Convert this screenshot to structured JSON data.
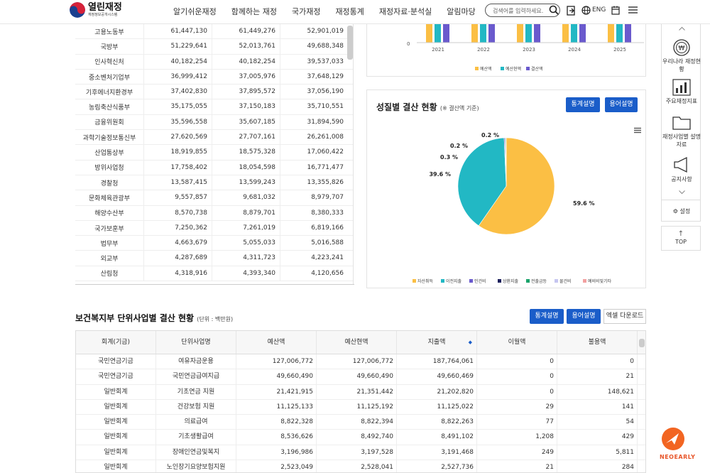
{
  "header": {
    "logo_title": "열린재정",
    "logo_sub": "재정정보공개시스템",
    "nav": [
      "알기쉬운재정",
      "함께하는 재정",
      "국가재정",
      "재정통계",
      "재정자료·분석실",
      "알림마당"
    ],
    "search_placeholder": "검색어를 입력하세요.",
    "lang": "ENG"
  },
  "ministry_table": {
    "rows": [
      [
        "고용노동부",
        "61,447,130",
        "61,449,276",
        "52,901,019"
      ],
      [
        "국방부",
        "51,229,641",
        "52,013,761",
        "49,688,348"
      ],
      [
        "인사혁신처",
        "40,182,254",
        "40,182,254",
        "39,537,033"
      ],
      [
        "중소벤처기업부",
        "36,999,412",
        "37,005,976",
        "37,648,129"
      ],
      [
        "기후에너지환경부",
        "37,402,830",
        "37,895,572",
        "37,056,190"
      ],
      [
        "농림축산식품부",
        "35,175,055",
        "37,150,183",
        "35,710,551"
      ],
      [
        "금융위원회",
        "35,596,558",
        "35,607,185",
        "31,894,590"
      ],
      [
        "과학기술정보통신부",
        "27,620,569",
        "27,707,161",
        "26,261,008"
      ],
      [
        "산업통상부",
        "18,919,855",
        "18,575,328",
        "17,060,422"
      ],
      [
        "방위사업청",
        "17,758,402",
        "18,054,598",
        "16,771,477"
      ],
      [
        "경찰청",
        "13,587,415",
        "13,599,243",
        "13,355,826"
      ],
      [
        "문화체육관광부",
        "9,557,857",
        "9,681,032",
        "8,979,707"
      ],
      [
        "해양수산부",
        "8,570,738",
        "8,879,701",
        "8,380,333"
      ],
      [
        "국가보훈부",
        "7,250,362",
        "7,261,019",
        "6,819,166"
      ],
      [
        "법무부",
        "4,663,679",
        "5,055,033",
        "5,016,588"
      ],
      [
        "외교부",
        "4,287,689",
        "4,311,723",
        "4,223,241"
      ],
      [
        "산림청",
        "4,318,916",
        "4,393,340",
        "4,120,656"
      ]
    ]
  },
  "top_chart": {
    "zero_label": "0",
    "years": [
      "2021",
      "2022",
      "2023",
      "2024",
      "2025"
    ],
    "legend": [
      "예산액",
      "예산현액",
      "결산액"
    ],
    "colors": [
      "#fbbf44",
      "#22b8c4",
      "#6a5acd"
    ]
  },
  "pie_panel": {
    "title": "성질별 결산 현황",
    "subtitle": "(※ 결산액 기준)",
    "btn_stats": "통계설명",
    "btn_terms": "용어설명",
    "labels": [
      "59.6 %",
      "39.6 %",
      "0.3 %",
      "0.2 %",
      "0.2 %"
    ],
    "legend": [
      {
        "name": "자산취득",
        "color": "#fbbf44"
      },
      {
        "name": "이전지출",
        "color": "#22b8c4"
      },
      {
        "name": "인건비",
        "color": "#6a5acd"
      },
      {
        "name": "상환지출",
        "color": "#1b1f5c"
      },
      {
        "name": "전출금등",
        "color": "#1aa36b"
      },
      {
        "name": "물건비",
        "color": "#c6c6f0"
      },
      {
        "name": "예비비및기타",
        "color": "#f2a0a0"
      }
    ]
  },
  "chart_data": {
    "type": "pie",
    "title": "성질별 결산 현황",
    "categories": [
      "자산취득",
      "이전지출",
      "인건비",
      "상환지출",
      "전출금등"
    ],
    "values": [
      59.6,
      39.6,
      0.3,
      0.2,
      0.2
    ],
    "colors": [
      "#fbbf44",
      "#22b8c4",
      "#6a5acd",
      "#1b1f5c",
      "#1aa36b"
    ]
  },
  "sidebar": {
    "items": [
      "우리나라 재정현황",
      "주요재정지표",
      "재정사업별 설명자료",
      "공지사항"
    ],
    "settings": "설정",
    "top": "TOP"
  },
  "bottom": {
    "title": "보건복지부 단위사업별 결산 현황",
    "unit": "(단위 : 백만원)",
    "btn_stats": "통계설명",
    "btn_terms": "용어설명",
    "btn_excel": "엑셀 다운로드",
    "headers": [
      "회계(기금)",
      "단위사업명",
      "예산액",
      "예산현액",
      "지출액",
      "이월액",
      "불용액"
    ],
    "sort_icon": "◆",
    "rows": [
      [
        "국민연금기금",
        "여유자금운용",
        "127,006,772",
        "127,006,772",
        "187,764,061",
        "0",
        "0"
      ],
      [
        "국민연금기금",
        "국민연금급여지급",
        "49,660,490",
        "49,660,490",
        "49,660,469",
        "0",
        "21"
      ],
      [
        "일반회계",
        "기초연금 지원",
        "21,421,915",
        "21,351,442",
        "21,202,820",
        "0",
        "148,621"
      ],
      [
        "일반회계",
        "건강보험 지원",
        "11,125,133",
        "11,125,192",
        "11,125,022",
        "29",
        "141"
      ],
      [
        "일반회계",
        "의료급여",
        "8,822,328",
        "8,822,394",
        "8,822,263",
        "77",
        "54"
      ],
      [
        "일반회계",
        "기초생활급여",
        "8,536,626",
        "8,492,740",
        "8,491,102",
        "1,208",
        "429"
      ],
      [
        "일반회계",
        "장애인연금및복지",
        "3,196,986",
        "3,197,528",
        "3,191,468",
        "249",
        "5,811"
      ],
      [
        "일반회계",
        "노인장기요양보험지원",
        "2,523,049",
        "2,528,041",
        "2,527,736",
        "21",
        "284"
      ]
    ]
  },
  "watermark": "NEOEARLY"
}
